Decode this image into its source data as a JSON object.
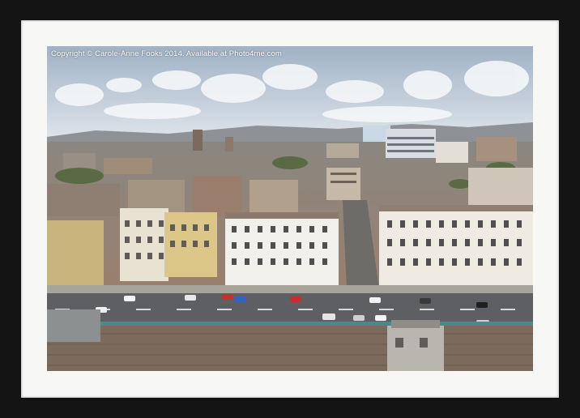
{
  "watermark": {
    "text": "Copyright © Carole-Anne Fooks 2014. Available at Photo4me.com"
  },
  "photo": {
    "subject": "aerial view of seafront town",
    "colors": {
      "frame": "#141414",
      "mount": "#f7f7f5",
      "sky": "#c9d3de",
      "road": "#5d5f62",
      "roof": "#7c6a5d"
    }
  }
}
